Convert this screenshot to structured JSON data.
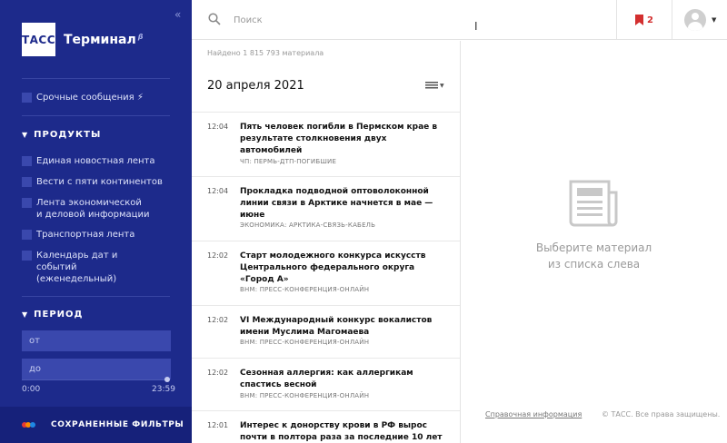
{
  "sidebar": {
    "logo_text": "ТАСС",
    "app_title": "Терминал",
    "beta_mark": "β",
    "urgent_label": "Срочные сообщения",
    "products_heading": "ПРОДУКТЫ",
    "products": [
      {
        "label": "Единая новостная лента"
      },
      {
        "label": "Вести с пяти континентов"
      },
      {
        "label": "Лента экономической и деловой информации"
      },
      {
        "label": "Транспортная лента"
      },
      {
        "label": "Календарь дат и событий (еженедельный)"
      }
    ],
    "period_heading": "ПЕРИОД",
    "from_placeholder": "от",
    "to_placeholder": "до",
    "time_start": "0:00",
    "time_end": "23:59",
    "saved_filters": "СОХРАНЕННЫЕ ФИЛЬТРЫ",
    "saved_dot_colors": [
      "#e53935",
      "#fb8c00",
      "#1e88e5"
    ]
  },
  "topbar": {
    "search_placeholder": "Поиск",
    "bookmarks_count": "2",
    "bookmark_color": "#d32f2f"
  },
  "list": {
    "found_text": "Найдено 1 815 793 материала",
    "date_heading": "20 апреля 2021",
    "items": [
      {
        "time": "12:04",
        "title": "Пять человек погибли в Пермском крае в результате столкновения двух автомобилей",
        "tags": "ЧП: ПЕРМЬ-ДТП-ПОГИБШИЕ"
      },
      {
        "time": "12:04",
        "title": "Прокладка подводной оптоволоконной линии связи в Арктике начнется в мае — июне",
        "tags": "ЭКОНОМИКА: АРКТИКА-СВЯЗЬ-КАБЕЛЬ"
      },
      {
        "time": "12:02",
        "title": "Старт молодежного конкурса искусств Центрального федерального округа «Город А»",
        "tags": "ВНМ: ПРЕСС-КОНФЕРЕНЦИЯ-ОНЛАЙН"
      },
      {
        "time": "12:02",
        "title": "VI Международный конкурс вокалистов имени Муслима Магомаева",
        "tags": "ВНМ: ПРЕСС-КОНФЕРЕНЦИЯ-ОНЛАЙН"
      },
      {
        "time": "12:02",
        "title": "Сезонная аллергия: как аллергикам спастись весной",
        "tags": "ВНМ: ПРЕСС-КОНФЕРЕНЦИЯ-ОНЛАЙН"
      },
      {
        "time": "12:01",
        "title": "Интерес к донорству крови в РФ вырос почти в полтора раза за последние 10 лет",
        "tags": ""
      }
    ]
  },
  "pane": {
    "empty_line1": "Выберите материал",
    "empty_line2": "из списка слева",
    "reference_link": "Справочная информация",
    "copyright": "© ТАСС. Все права защищены."
  }
}
